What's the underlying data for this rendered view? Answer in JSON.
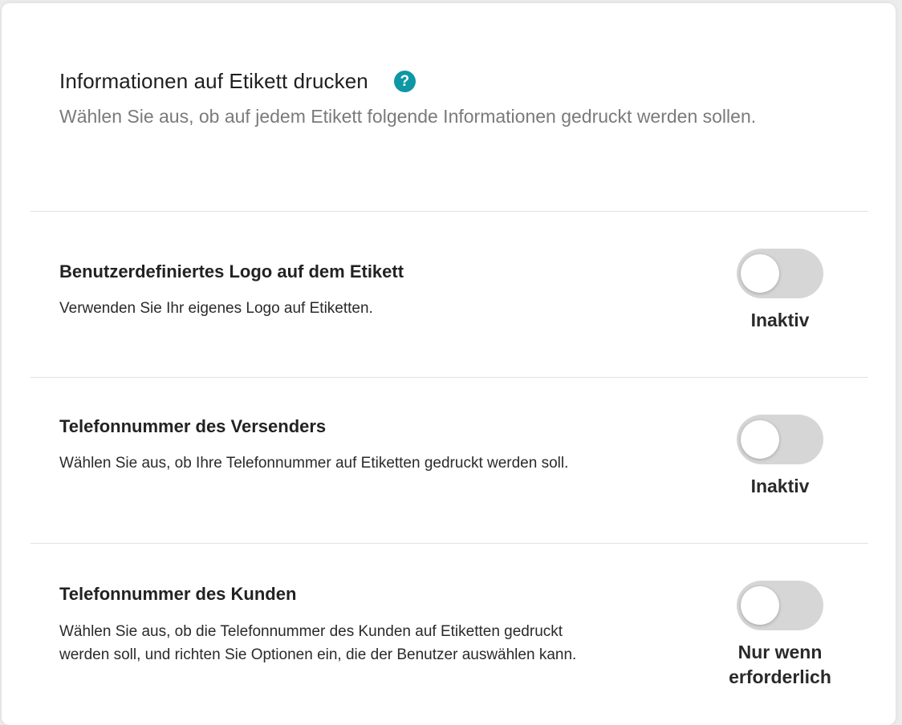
{
  "header": {
    "title": "Informationen auf Etikett drucken",
    "help_icon": "question-mark-icon",
    "description": "Wählen Sie aus, ob auf jedem Etikett folgende Informationen gedruckt werden sollen."
  },
  "settings": [
    {
      "title": "Benutzerdefiniertes Logo auf dem Etikett",
      "description": "Verwenden Sie Ihr eigenes Logo auf Etiketten.",
      "enabled": false,
      "status": "Inaktiv"
    },
    {
      "title": "Telefonnummer des Versenders",
      "description": "Wählen Sie aus, ob Ihre Telefonnummer auf Etiketten gedruckt werden soll.",
      "enabled": false,
      "status": "Inaktiv"
    },
    {
      "title": "Telefonnummer des Kunden",
      "description": "Wählen Sie aus, ob die Telefonnummer des Kunden auf Etiketten gedruckt werden soll, und richten Sie Optionen ein, die der Benutzer auswählen kann.",
      "enabled": false,
      "status": "Nur wenn erforderlich"
    }
  ],
  "colors": {
    "accent": "#0e97a5",
    "toggle_off": "#d6d6d6"
  }
}
